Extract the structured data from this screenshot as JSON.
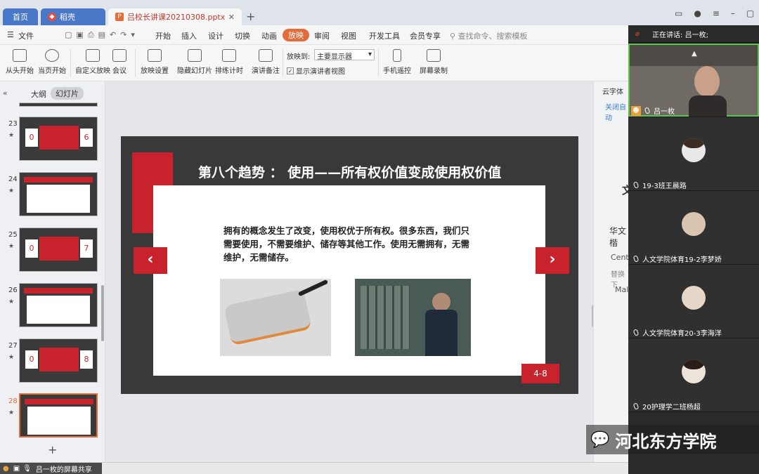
{
  "tabs": {
    "home": "首页",
    "daoke": "稻壳",
    "file": "吕校长讲课20210308.pptx"
  },
  "menu": {
    "file": "文件",
    "items": [
      "开始",
      "插入",
      "设计",
      "切换",
      "动画",
      "放映",
      "审阅",
      "视图",
      "开发工具",
      "会员专享"
    ],
    "search": "查找命令、搜索模板"
  },
  "ribbon": {
    "from_start": "从头开始",
    "from_current": "当页开始",
    "custom_show": "自定义放映",
    "meeting": "会议",
    "show_settings": "放映设置",
    "hide_slide": "隐藏幻灯片",
    "rehearse": "排练计时",
    "speaker_notes": "演讲备注",
    "show_to_label": "放映到:",
    "show_to_value": "主要显示器",
    "presenter_view": "显示演讲者视图",
    "phone_remote": "手机遥控",
    "screen_record": "屏幕录制"
  },
  "panel": {
    "outline": "大纲",
    "slides": "幻灯片",
    "numbers": [
      "23",
      "24",
      "25",
      "26",
      "27",
      "28"
    ],
    "add": "+"
  },
  "thumbs": {
    "t23": [
      "0",
      "6"
    ],
    "t25": [
      "0",
      "7"
    ],
    "t27": [
      "0",
      "8"
    ]
  },
  "slide": {
    "title": "第八个趋势 ： 使用——所有权价值变成使用权价值",
    "body": "拥有的概念发生了改变，使用权优于所有权。很多东西，我们只需要使用，不需要维护、储存等其他工作。使用无需拥有，无需维护，无需储存。",
    "page": "4-8"
  },
  "side": {
    "cloud_font": "云字体",
    "close_auto": "关闭自动",
    "wen": "文",
    "huawen": "华文楷",
    "centu": "Centu",
    "replace": "替换下",
    "male": "Male"
  },
  "status": {
    "share": "吕一枚的屏幕共享"
  },
  "meeting": {
    "speaking": "正在讲话: 吕一枚;",
    "participants": [
      "吕一枚",
      "19-3班王晨路",
      "人文学院体育19-2李梦娇",
      "人文学院体育20-3李海洋",
      "20护理学二班杨超"
    ]
  },
  "watermark": "河北东方学院",
  "colors": {
    "accent_red": "#c8232c",
    "wps_orange": "#e26c3a",
    "tab_blue": "#4a78c8",
    "active_speaker": "#5ec44e"
  }
}
